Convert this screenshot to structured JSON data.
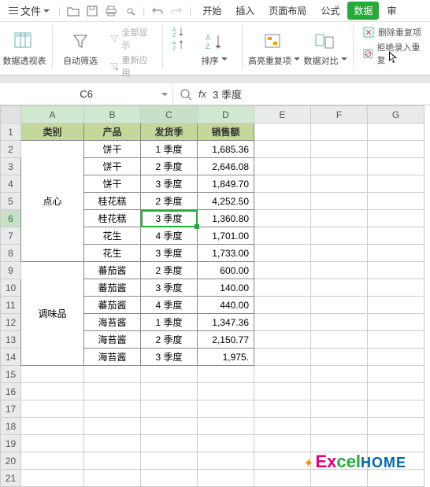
{
  "menu": {
    "file": "文件",
    "tabs": [
      "开始",
      "插入",
      "页面布局",
      "公式",
      "数据",
      "审"
    ],
    "active_tab": "数据"
  },
  "ribbon": {
    "pivot": "数据透视表",
    "autofilter": "自动筛选",
    "show_all": "全部显示",
    "reapply": "重新应用",
    "sort": "排序",
    "highlight_dup": "高亮重复项",
    "data_compare": "数据对比",
    "remove_dup": "删除重复项",
    "reject_dup": "拒绝录入重复"
  },
  "formula_bar": {
    "namebox": "C6",
    "fx": "fx",
    "value": "3 季度"
  },
  "columns": [
    "A",
    "B",
    "C",
    "D",
    "E",
    "F",
    "G"
  ],
  "headers": [
    "类别",
    "产品",
    "发货季",
    "销售额"
  ],
  "rows": [
    {
      "n": 1,
      "a": "类别",
      "b": "产品",
      "c": "发货季",
      "d": "销售额",
      "hdr": true
    },
    {
      "n": 2,
      "a": "",
      "b": "饼干",
      "c": "1 季度",
      "d": "1,685.36"
    },
    {
      "n": 3,
      "a": "",
      "b": "饼干",
      "c": "2 季度",
      "d": "2,646.08"
    },
    {
      "n": 4,
      "a": "",
      "b": "饼干",
      "c": "3 季度",
      "d": "1,849.70"
    },
    {
      "n": 5,
      "a": "点心",
      "b": "桂花糕",
      "c": "2 季度",
      "d": "4,252.50"
    },
    {
      "n": 6,
      "a": "",
      "b": "桂花糕",
      "c": "3 季度",
      "d": "1,360.80",
      "active": true
    },
    {
      "n": 7,
      "a": "",
      "b": "花生",
      "c": "4 季度",
      "d": "1,701.00"
    },
    {
      "n": 8,
      "a": "",
      "b": "花生",
      "c": "3 季度",
      "d": "1,733.00"
    },
    {
      "n": 9,
      "a": "",
      "b": "蕃茄酱",
      "c": "2 季度",
      "d": "600.00"
    },
    {
      "n": 10,
      "a": "",
      "b": "蕃茄酱",
      "c": "3 季度",
      "d": "140.00"
    },
    {
      "n": 11,
      "a": "调味品",
      "b": "蕃茄酱",
      "c": "4 季度",
      "d": "440.00"
    },
    {
      "n": 12,
      "a": "",
      "b": "海苔酱",
      "c": "1 季度",
      "d": "1,347.36"
    },
    {
      "n": 13,
      "a": "",
      "b": "海苔酱",
      "c": "2 季度",
      "d": "2,150.77"
    },
    {
      "n": 14,
      "a": "",
      "b": "海苔酱",
      "c": "3 季度",
      "d": "1,975."
    }
  ],
  "merges": [
    {
      "col": "a",
      "start": 2,
      "end": 8,
      "text": "点心"
    },
    {
      "col": "a",
      "start": 9,
      "end": 14,
      "text": "调味品"
    }
  ],
  "empty_rows": [
    15,
    16,
    17,
    18,
    19,
    20,
    21
  ],
  "watermark": {
    "part1": "Ex",
    "part2": "cel",
    "part3": "HOME"
  },
  "active_col": "C",
  "active_row": 6
}
